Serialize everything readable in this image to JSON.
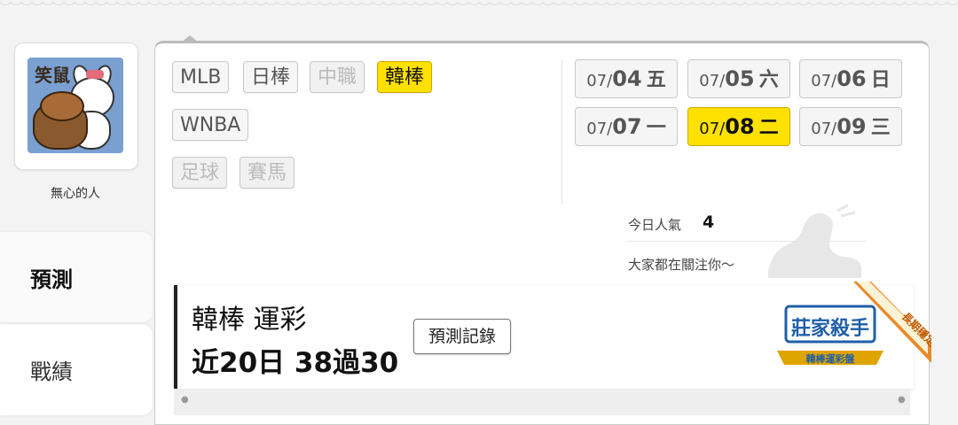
{
  "profile": {
    "avatar_caption": "笑鼠",
    "username": "無心的人"
  },
  "sidebar": {
    "tabs": [
      {
        "label": "預測",
        "active": true
      },
      {
        "label": "戰績",
        "active": false
      }
    ]
  },
  "categories": [
    {
      "label": "MLB",
      "state": "normal"
    },
    {
      "label": "日棒",
      "state": "normal"
    },
    {
      "label": "中職",
      "state": "disabled"
    },
    {
      "label": "韓棒",
      "state": "active"
    },
    {
      "label": "WNBA",
      "state": "normal"
    },
    {
      "label": "足球",
      "state": "disabled"
    },
    {
      "label": "賽馬",
      "state": "disabled"
    }
  ],
  "dates": [
    {
      "month": "07/",
      "day": "04",
      "weekday": "五",
      "active": false
    },
    {
      "month": "07/",
      "day": "05",
      "weekday": "六",
      "active": false
    },
    {
      "month": "07/",
      "day": "06",
      "weekday": "日",
      "active": false
    },
    {
      "month": "07/",
      "day": "07",
      "weekday": "一",
      "active": false
    },
    {
      "month": "07/",
      "day": "08",
      "weekday": "二",
      "active": true
    },
    {
      "month": "07/",
      "day": "09",
      "weekday": "三",
      "active": false
    }
  ],
  "stats": {
    "popularity_label": "今日人氣",
    "popularity_value": "4",
    "follow_text": "大家都在關注你～"
  },
  "ranking": {
    "title": "韓棒 運彩",
    "record": "近20日 38過30",
    "history_button": "預測記錄",
    "badge_main": "莊家殺手",
    "badge_sub": "韓棒運彩盤",
    "ribbon": "長期穩定"
  },
  "colors": {
    "active_yellow": "#ffe100",
    "badge_blue": "#1f5fa8",
    "badge_gold": "#e0a400",
    "ribbon_orange": "#e88a2a"
  }
}
